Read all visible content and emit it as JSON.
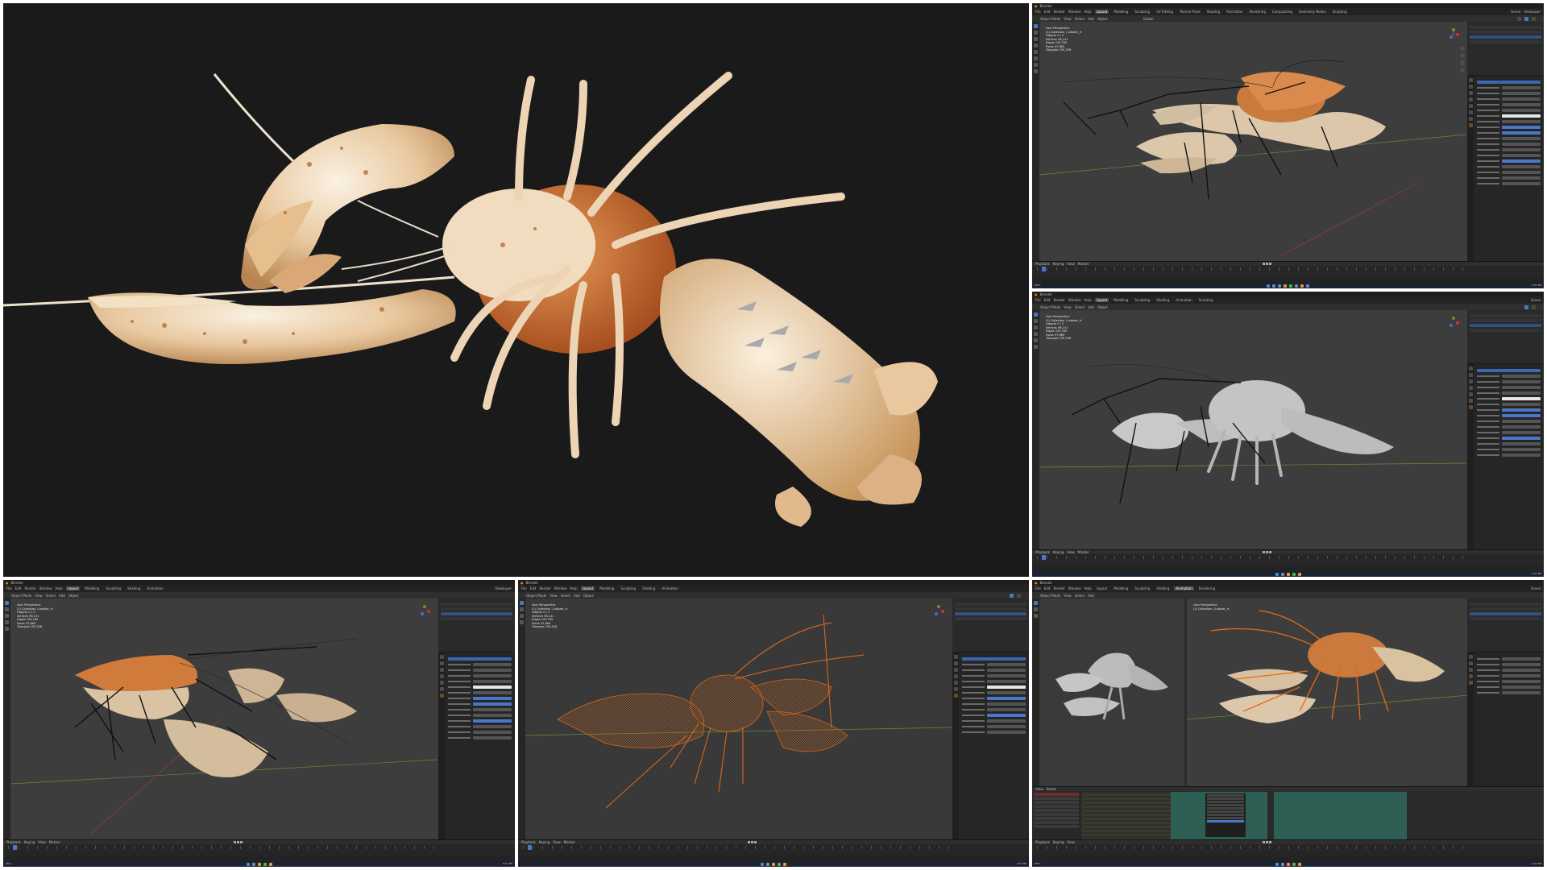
{
  "hero": {
    "background": "#1a1a1a",
    "shell_color": "#e9c89f",
    "body_color": "#c9612a"
  },
  "blender": {
    "app_name": "Blender",
    "menus": [
      "File",
      "Edit",
      "Render",
      "Window",
      "Help"
    ],
    "workspaces": [
      "Layout",
      "Modeling",
      "Sculpting",
      "UV Editing",
      "Texture Paint",
      "Shading",
      "Animation",
      "Rendering",
      "Compositing",
      "Geometry Nodes",
      "Scripting"
    ],
    "active_workspace": "Layout",
    "animation_workspace": "Animation",
    "scene": "Scene",
    "view_layer": "ViewLayer",
    "viewport": {
      "title": "User Perspective",
      "collection": "(1) Collection | Lobster_rt",
      "stats": [
        {
          "label": "Objects",
          "value": "0 / 3"
        },
        {
          "label": "Vertices",
          "value": "98,141"
        },
        {
          "label": "Edges",
          "value": "195,769"
        },
        {
          "label": "Faces",
          "value": "97,669"
        },
        {
          "label": "Triangles",
          "value": "195,256"
        }
      ]
    },
    "viewport_modes": {
      "object_mode": "Object Mode",
      "view": "View",
      "select": "Select",
      "add": "Add",
      "object": "Object",
      "global": "Global"
    },
    "outliner": {
      "root": "Scene Collection",
      "items": [
        "Collection",
        "Armature",
        "Lobster_rt"
      ]
    },
    "properties": {
      "surface": "Surface",
      "surface_type": "Principled BSDF",
      "base_color": "Base Color",
      "base_color_tex": "Lobster_AO_Diffuse",
      "subsurface": "Subsurface",
      "metallic": "Metallic",
      "specular": "Specular",
      "roughness": "Roughness",
      "ior": "IOR",
      "alpha": "Alpha",
      "normal": "Normal"
    },
    "timeline": {
      "menus": [
        "Playback",
        "Keying",
        "View",
        "Marker"
      ],
      "start": "1",
      "end": "250",
      "current": "1"
    },
    "statusbar": {
      "select": "Select",
      "rotate": "Rotate View",
      "context": "Object Context Menu"
    },
    "taskbar": {
      "weather_temp": "28°C",
      "weather_desc": "Sunny",
      "lang": "ENG",
      "time": "9:57 PM",
      "date": "3/14/2024"
    },
    "accent": "#4a77c7"
  }
}
